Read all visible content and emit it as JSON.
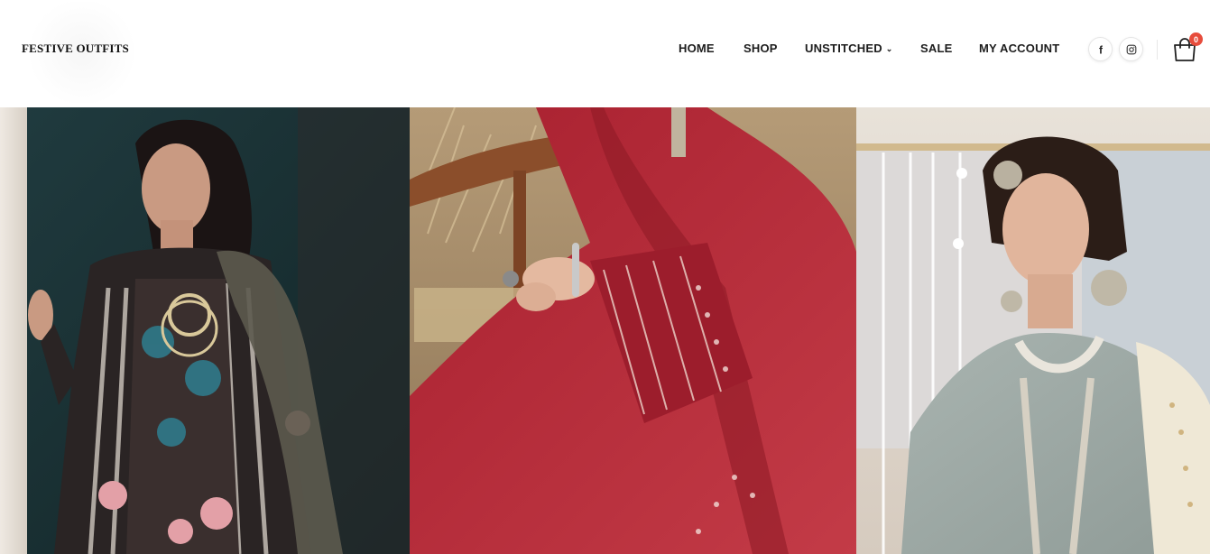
{
  "header": {
    "logo_text": "FESTIVE OUTFITS",
    "nav": [
      {
        "label": "HOME"
      },
      {
        "label": "SHOP"
      },
      {
        "label": "UNSTITCHED",
        "has_dropdown": true
      },
      {
        "label": "SALE"
      },
      {
        "label": "MY ACCOUNT"
      }
    ],
    "social": [
      {
        "icon": "facebook-icon",
        "glyph": "f"
      },
      {
        "icon": "instagram-icon"
      }
    ],
    "cart": {
      "icon": "shopping-bag-icon",
      "count": "0"
    }
  },
  "colors": {
    "badge": "#e74c3c",
    "panel_1_bg": "#1f3a3d",
    "panel_2_bg": "#b22a38",
    "panel_3_bg": "#e9e4df"
  },
  "hero": {
    "panels": [
      {
        "name": "model-black-embroidered-outfit"
      },
      {
        "name": "model-red-embroidered-outfit"
      },
      {
        "name": "model-mint-bridal-outfit"
      }
    ]
  }
}
